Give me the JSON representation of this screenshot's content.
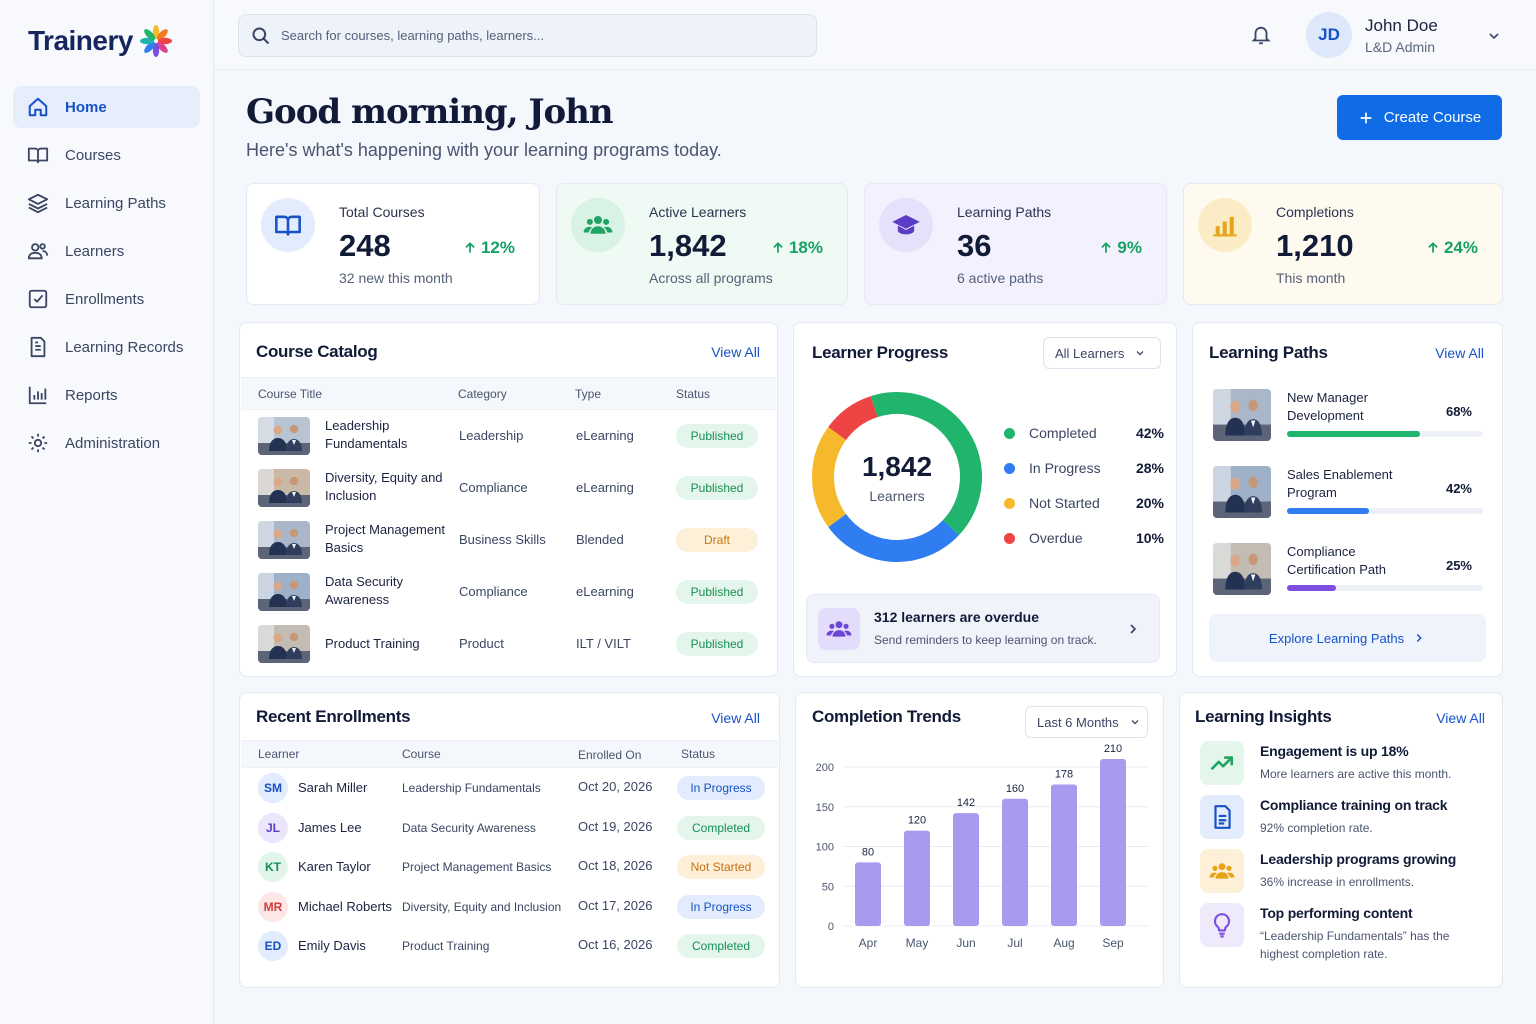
{
  "app": {
    "name": "Trainery"
  },
  "sidebar": {
    "items": [
      {
        "label": "Home",
        "icon": "home-icon",
        "active": true
      },
      {
        "label": "Courses",
        "icon": "book-open-icon"
      },
      {
        "label": "Learning Paths",
        "icon": "layers-icon"
      },
      {
        "label": "Learners",
        "icon": "users-icon"
      },
      {
        "label": "Enrollments",
        "icon": "edit-check-icon"
      },
      {
        "label": "Learning Records",
        "icon": "document-icon"
      },
      {
        "label": "Reports",
        "icon": "bar-chart-icon"
      },
      {
        "label": "Administration",
        "icon": "gear-icon"
      }
    ]
  },
  "topbar": {
    "search_placeholder": "Search for courses, learning paths, learners...",
    "user": {
      "initials": "JD",
      "name": "John Doe",
      "role": "L&D Admin"
    }
  },
  "header": {
    "greeting": "Good morning, John",
    "subtitle": "Here's what's happening with your learning programs today.",
    "create_button": "Create Course"
  },
  "stats": [
    {
      "label": "Total Courses",
      "value": "248",
      "change": "12%",
      "sub": "32 new this month",
      "icon": "book-icon",
      "bg": "#ffffff",
      "accent": "#1752c7"
    },
    {
      "label": "Active Learners",
      "value": "1,842",
      "change": "18%",
      "sub": "Across all programs",
      "icon": "users-icon",
      "bg": "#eefaf3",
      "accent": "#20a464"
    },
    {
      "label": "Learning Paths",
      "value": "36",
      "change": "9%",
      "sub": "6 active paths",
      "icon": "graduation-cap-icon",
      "bg": "#f3f1fd",
      "accent": "#5b3cc4"
    },
    {
      "label": "Completions",
      "value": "1,210",
      "change": "24%",
      "sub": "This month",
      "icon": "bar-chart-icon",
      "bg": "#fefaef",
      "accent": "#e8a317"
    }
  ],
  "course_catalog": {
    "title": "Course Catalog",
    "view_all": "View All",
    "columns": [
      "Course Title",
      "Category",
      "Type",
      "Status"
    ],
    "rows": [
      {
        "title": "Leadership Fundamentals",
        "category": "Leadership",
        "type": "eLearning",
        "status": "Published"
      },
      {
        "title": "Diversity, Equity and Inclusion",
        "category": "Compliance",
        "type": "eLearning",
        "status": "Published"
      },
      {
        "title": "Project Management Basics",
        "category": "Business Skills",
        "type": "Blended",
        "status": "Draft"
      },
      {
        "title": "Data Security Awareness",
        "category": "Compliance",
        "type": "eLearning",
        "status": "Published"
      },
      {
        "title": "Product Training",
        "category": "Product",
        "type": "ILT / VILT",
        "status": "Published"
      }
    ]
  },
  "learner_progress": {
    "title": "Learner Progress",
    "filter": "All Learners",
    "total": "1,842",
    "total_label": "Learners",
    "segments": [
      {
        "name": "Completed",
        "percent": 42,
        "label": "42%",
        "color": "#20b46c"
      },
      {
        "name": "In Progress",
        "percent": 28,
        "label": "28%",
        "color": "#2f7df0"
      },
      {
        "name": "Not Started",
        "percent": 20,
        "label": "20%",
        "color": "#f6b92b"
      },
      {
        "name": "Overdue",
        "percent": 10,
        "label": "10%",
        "color": "#ef4444"
      }
    ],
    "alert_title": "312 learners are overdue",
    "alert_text": "Send reminders to keep learning on track."
  },
  "learning_paths": {
    "title": "Learning Paths",
    "view_all": "View All",
    "items": [
      {
        "name": "New Manager Development",
        "percent": 68,
        "label": "68%",
        "color": "#20b46c"
      },
      {
        "name": "Sales Enablement Program",
        "percent": 42,
        "label": "42%",
        "color": "#2f7df0"
      },
      {
        "name": "Compliance Certification Path",
        "percent": 25,
        "label": "25%",
        "color": "#7c4fe0"
      }
    ],
    "explore": "Explore Learning Paths"
  },
  "recent_enrollments": {
    "title": "Recent Enrollments",
    "view_all": "View All",
    "columns": [
      "Learner",
      "Course",
      "Enrolled On",
      "Status"
    ],
    "rows": [
      {
        "initials": "SM",
        "name": "Sarah Miller",
        "course": "Leadership Fundamentals",
        "date": "Oct 20, 2026",
        "status": "In Progress",
        "avatar_bg": "#e1ecfc",
        "avatar_fg": "#1752c7"
      },
      {
        "initials": "JL",
        "name": "James Lee",
        "course": "Data Security Awareness",
        "date": "Oct 19, 2026",
        "status": "Completed",
        "avatar_bg": "#ebe6fb",
        "avatar_fg": "#5b3cc4"
      },
      {
        "initials": "KT",
        "name": "Karen Taylor",
        "course": "Project Management Basics",
        "date": "Oct 18, 2026",
        "status": "Not Started",
        "avatar_bg": "#e2f5ea",
        "avatar_fg": "#158f54"
      },
      {
        "initials": "MR",
        "name": "Michael Roberts",
        "course": "Diversity, Equity and Inclusion",
        "date": "Oct 17, 2026",
        "status": "In Progress",
        "avatar_bg": "#fde6e6",
        "avatar_fg": "#d33a3a"
      },
      {
        "initials": "ED",
        "name": "Emily Davis",
        "course": "Product Training",
        "date": "Oct 16, 2026",
        "status": "Completed",
        "avatar_bg": "#e1ecfc",
        "avatar_fg": "#1752c7"
      }
    ]
  },
  "completion_trends": {
    "title": "Completion Trends",
    "filter": "Last 6 Months"
  },
  "chart_data": {
    "type": "bar",
    "categories": [
      "Apr",
      "May",
      "Jun",
      "Jul",
      "Aug",
      "Sep"
    ],
    "values": [
      80,
      120,
      142,
      160,
      178,
      210
    ],
    "ylim": [
      0,
      200
    ],
    "yticks": [
      0,
      50,
      100,
      150,
      200
    ],
    "grid": true,
    "color": "#a99af0"
  },
  "insights": {
    "title": "Learning Insights",
    "view_all": "View All",
    "items": [
      {
        "title": "Engagement is up 18%",
        "text": "More learners are active this month.",
        "icon": "trending-up-icon",
        "bg": "#e4f6ec",
        "fg": "#20a464"
      },
      {
        "title": "Compliance training on track",
        "text": "92% completion rate.",
        "icon": "document-icon",
        "bg": "#e3ecfc",
        "fg": "#1752c7"
      },
      {
        "title": "Leadership programs growing",
        "text": "36% increase in enrollments.",
        "icon": "users-icon",
        "bg": "#fdf0d9",
        "fg": "#e8a317"
      },
      {
        "title": "Top performing content",
        "text": "“Leadership Fundamentals” has the highest completion rate.",
        "icon": "lightbulb-icon",
        "bg": "#efe9fc",
        "fg": "#7c4fe0"
      }
    ]
  }
}
